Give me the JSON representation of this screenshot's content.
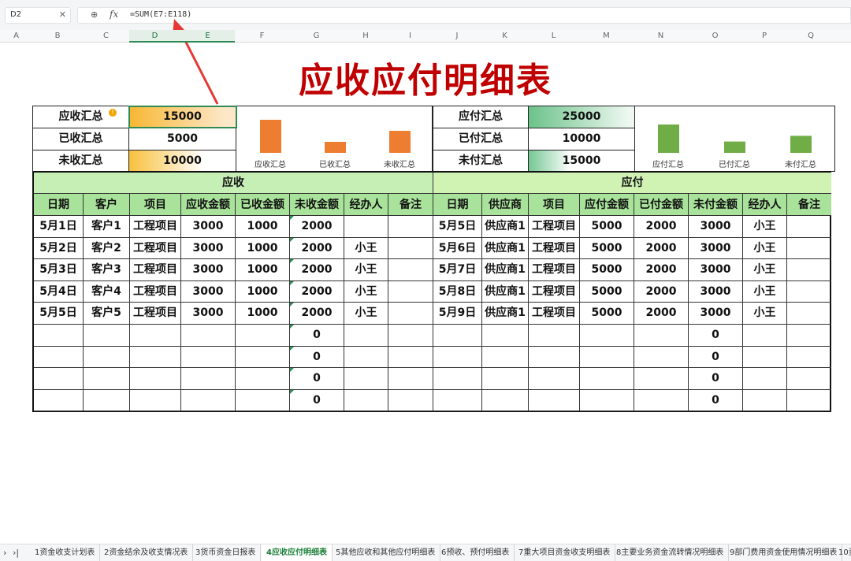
{
  "formula_bar": {
    "name_box": "D2",
    "close_glyph": "✕",
    "zoom_glyph": "⊕",
    "fx_glyph": "fx",
    "formula": "=SUM(E7:E118)"
  },
  "columns": [
    "A",
    "B",
    "C",
    "D",
    "E",
    "F",
    "G",
    "H",
    "I",
    "J",
    "K",
    "L",
    "M",
    "N",
    "O",
    "P",
    "Q"
  ],
  "selected_columns": [
    "D",
    "E"
  ],
  "title": "应收应付明细表",
  "receivable_summary": {
    "rows": [
      {
        "label": "应收汇总",
        "value": "15000"
      },
      {
        "label": "已收汇总",
        "value": "5000"
      },
      {
        "label": "未收汇总",
        "value": "10000"
      }
    ],
    "warning_glyph": "!",
    "chart": {
      "type": "bar",
      "categories": [
        "应收汇总",
        "已收汇总",
        "未收汇总"
      ],
      "values": [
        15000,
        5000,
        10000
      ],
      "color": "#ed7d31"
    }
  },
  "payable_summary": {
    "rows": [
      {
        "label": "应付汇总",
        "value": "25000"
      },
      {
        "label": "已付汇总",
        "value": "10000"
      },
      {
        "label": "未付汇总",
        "value": "15000"
      }
    ],
    "chart": {
      "type": "bar",
      "categories": [
        "应付汇总",
        "已付汇总",
        "未付汇总"
      ],
      "values": [
        25000,
        10000,
        15000
      ],
      "color": "#70ad47"
    }
  },
  "chart_data": [
    {
      "type": "bar",
      "categories": [
        "应收汇总",
        "已收汇总",
        "未收汇总"
      ],
      "values": [
        15000,
        5000,
        10000
      ]
    },
    {
      "type": "bar",
      "categories": [
        "应付汇总",
        "已付汇总",
        "未付汇总"
      ],
      "values": [
        25000,
        10000,
        15000
      ]
    }
  ],
  "table": {
    "receivable_title": "应收",
    "payable_title": "应付",
    "receivable_headers": [
      "日期",
      "客户",
      "项目",
      "应收金额",
      "已收金额",
      "未收金额",
      "经办人",
      "备注"
    ],
    "payable_headers": [
      "日期",
      "供应商",
      "项目",
      "应付金额",
      "已付金额",
      "未付金额",
      "经办人",
      "备注"
    ],
    "receivable_rows": [
      [
        "5月1日",
        "客户1",
        "工程项目",
        "3000",
        "1000",
        "2000",
        "",
        ""
      ],
      [
        "5月2日",
        "客户2",
        "工程项目",
        "3000",
        "1000",
        "2000",
        "小王",
        ""
      ],
      [
        "5月3日",
        "客户3",
        "工程项目",
        "3000",
        "1000",
        "2000",
        "小王",
        ""
      ],
      [
        "5月4日",
        "客户4",
        "工程项目",
        "3000",
        "1000",
        "2000",
        "小王",
        ""
      ],
      [
        "5月5日",
        "客户5",
        "工程项目",
        "3000",
        "1000",
        "2000",
        "小王",
        ""
      ],
      [
        "",
        "",
        "",
        "",
        "",
        "0",
        "",
        ""
      ],
      [
        "",
        "",
        "",
        "",
        "",
        "0",
        "",
        ""
      ],
      [
        "",
        "",
        "",
        "",
        "",
        "0",
        "",
        ""
      ],
      [
        "",
        "",
        "",
        "",
        "",
        "0",
        "",
        ""
      ]
    ],
    "payable_rows": [
      [
        "5月5日",
        "供应商1",
        "工程项目",
        "5000",
        "2000",
        "3000",
        "小王",
        ""
      ],
      [
        "5月6日",
        "供应商1",
        "工程项目",
        "5000",
        "2000",
        "3000",
        "小王",
        ""
      ],
      [
        "5月7日",
        "供应商1",
        "工程项目",
        "5000",
        "2000",
        "3000",
        "小王",
        ""
      ],
      [
        "5月8日",
        "供应商1",
        "工程项目",
        "5000",
        "2000",
        "3000",
        "小王",
        ""
      ],
      [
        "5月9日",
        "供应商1",
        "工程项目",
        "5000",
        "2000",
        "3000",
        "小王",
        ""
      ],
      [
        "",
        "",
        "",
        "",
        "",
        "0",
        "",
        ""
      ],
      [
        "",
        "",
        "",
        "",
        "",
        "0",
        "",
        ""
      ],
      [
        "",
        "",
        "",
        "",
        "",
        "0",
        "",
        ""
      ],
      [
        "",
        "",
        "",
        "",
        "",
        "0",
        "",
        ""
      ]
    ]
  },
  "tabs": {
    "nav_prev": "›",
    "nav_last": "›|",
    "items": [
      "1资金收支计划表",
      "2资金结余及收支情况表",
      "3货币资金日报表",
      "4应收应付明细表",
      "5其他应收和其他应付明细表",
      "6预收、预付明细表",
      "7重大项目资金收支明细表",
      "8主要业务资金流转情况明细表",
      "9部门费用资金使用情况明细表",
      "10资"
    ],
    "active_index": 3
  }
}
